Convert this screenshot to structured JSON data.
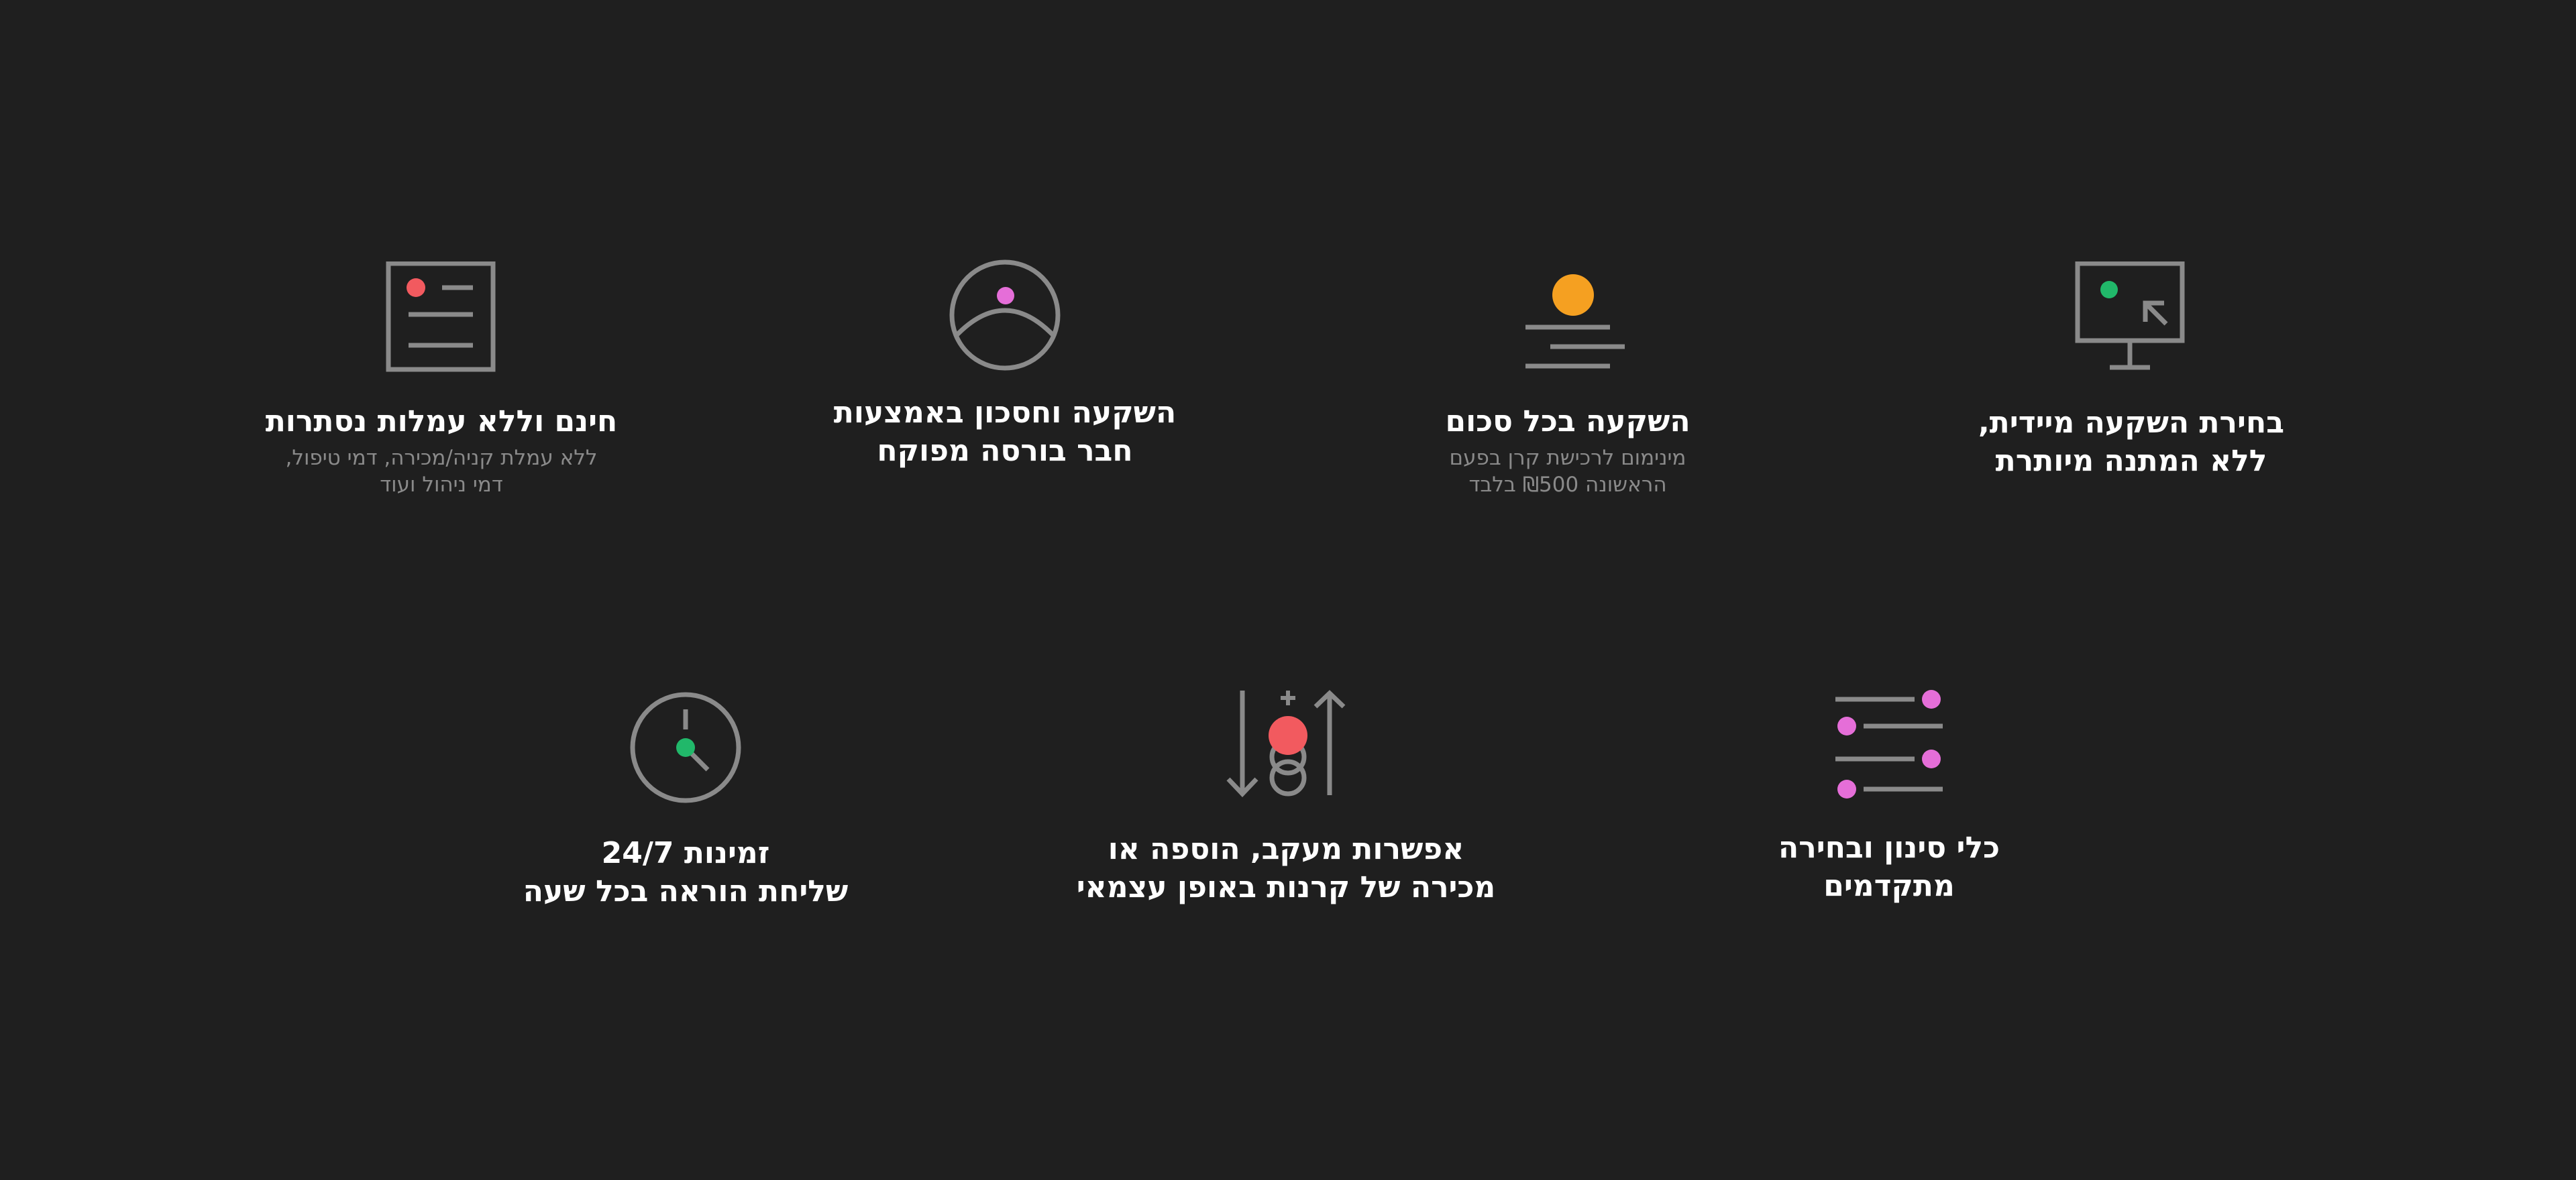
{
  "colors": {
    "background": "#1f1f1f",
    "icon_stroke": "#8a8a8a",
    "title": "#ffffff",
    "subtitle": "#8a8a8a",
    "dot_red": "#f25a5f",
    "dot_pink": "#e56ed8",
    "dot_orange": "#f5a021",
    "dot_green": "#21b86a"
  },
  "features": [
    {
      "icon": "monitor-cursor-icon",
      "title_lines": [
        "בחירת השקעה מיידית,",
        "ללא המתנה מיותרת"
      ]
    },
    {
      "icon": "coin-stack-icon",
      "title_lines": [
        "השקעה בכל סכום"
      ],
      "subtitle_lines": [
        "מינימום לרכישת קרן בפעם",
        "הראשונה ₪500 בלבד"
      ]
    },
    {
      "icon": "user-circle-icon",
      "title_lines": [
        "השקעה וחסכון באמצעות",
        "חבר בורסה מפוקח"
      ]
    },
    {
      "icon": "document-list-icon",
      "title_lines": [
        "חינם וללא עמלות נסתרות"
      ],
      "subtitle_lines": [
        "ללא עמלת קניה/מכירה, דמי טיפול,",
        "דמי ניהול ועוד"
      ]
    },
    {
      "icon": "filter-sliders-icon",
      "title_lines": [
        "כלי סינון ובחירה",
        "מתקדמים"
      ]
    },
    {
      "icon": "buy-sell-arrows-icon",
      "title_lines": [
        "אפשרות מעקב, הוספה או",
        "מכירה של קרנות באופן עצמאי"
      ]
    },
    {
      "icon": "clock-icon",
      "title_lines": [
        "זמינות 24/7",
        "שליחת הוראה בכל שעה"
      ]
    }
  ]
}
